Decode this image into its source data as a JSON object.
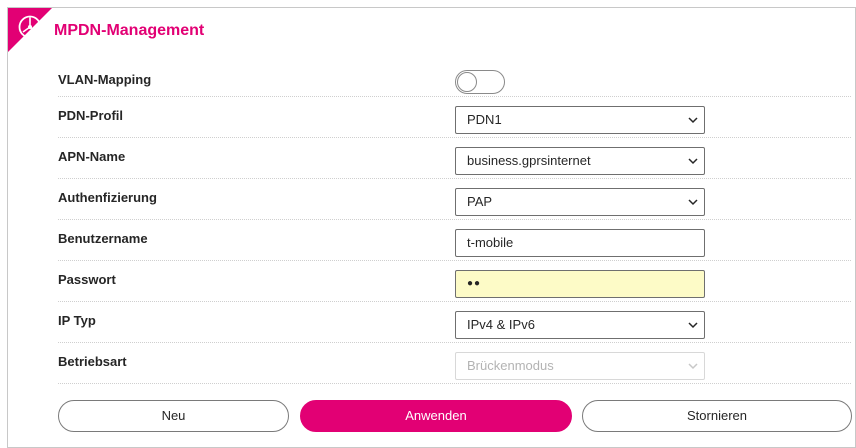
{
  "header": {
    "title": "MPDN-Management"
  },
  "form": {
    "vlan_mapping": {
      "label": "VLAN-Mapping",
      "enabled": false
    },
    "pdn_profil": {
      "label": "PDN-Profil",
      "value": "PDN1"
    },
    "apn_name": {
      "label": "APN-Name",
      "value": "business.gprsinternet"
    },
    "authentifizierung": {
      "label": "Authenfizierung",
      "value": "PAP"
    },
    "benutzername": {
      "label": "Benutzername",
      "value": "t-mobile"
    },
    "passwort": {
      "label": "Passwort",
      "value": "●●"
    },
    "ip_typ": {
      "label": "IP Typ",
      "value": "IPv4 & IPv6"
    },
    "betriebsart": {
      "label": "Betriebsart",
      "value": "Brückenmodus",
      "disabled": true
    }
  },
  "buttons": {
    "neu": "Neu",
    "anwenden": "Anwenden",
    "stornieren": "Stornieren"
  },
  "colors": {
    "brand": "#e20074",
    "password_bg": "#fdfbc7",
    "disabled_text": "#b3b3b3"
  },
  "icons": {
    "logo": "router-logo-icon",
    "select_arrow": "chevron-down-icon"
  }
}
